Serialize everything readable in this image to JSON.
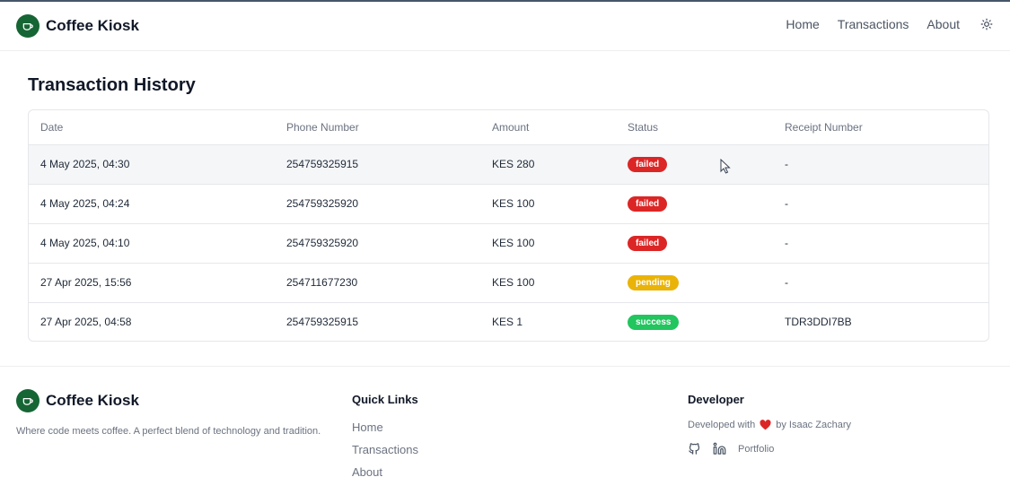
{
  "header": {
    "brand": "Coffee Kiosk",
    "nav": [
      "Home",
      "Transactions",
      "About"
    ],
    "theme_icon": "sun-icon"
  },
  "main": {
    "title": "Transaction History",
    "columns": [
      "Date",
      "Phone Number",
      "Amount",
      "Status",
      "Receipt Number"
    ],
    "rows": [
      {
        "date": "4 May 2025, 04:30",
        "phone": "254759325915",
        "amount": "KES 280",
        "status": "failed",
        "receipt": "-"
      },
      {
        "date": "4 May 2025, 04:24",
        "phone": "254759325920",
        "amount": "KES 100",
        "status": "failed",
        "receipt": "-"
      },
      {
        "date": "4 May 2025, 04:10",
        "phone": "254759325920",
        "amount": "KES 100",
        "status": "failed",
        "receipt": "-"
      },
      {
        "date": "27 Apr 2025, 15:56",
        "phone": "254711677230",
        "amount": "KES 100",
        "status": "pending",
        "receipt": "-"
      },
      {
        "date": "27 Apr 2025, 04:58",
        "phone": "254759325915",
        "amount": "KES 1",
        "status": "success",
        "receipt": "TDR3DDI7BB"
      }
    ]
  },
  "footer": {
    "brand": "Coffee Kiosk",
    "tagline": "Where code meets coffee. A perfect blend of technology and tradition.",
    "quick_links_heading": "Quick Links",
    "quick_links": [
      "Home",
      "Transactions",
      "About"
    ],
    "developer_heading": "Developer",
    "developed_with": "Developed with",
    "developer_name": "by Isaac Zachary",
    "portfolio": "Portfolio"
  },
  "colors": {
    "brand": "#166534",
    "failed": "#dc2626",
    "pending": "#eab308",
    "success": "#22c55e",
    "heart": "#dc2626"
  }
}
